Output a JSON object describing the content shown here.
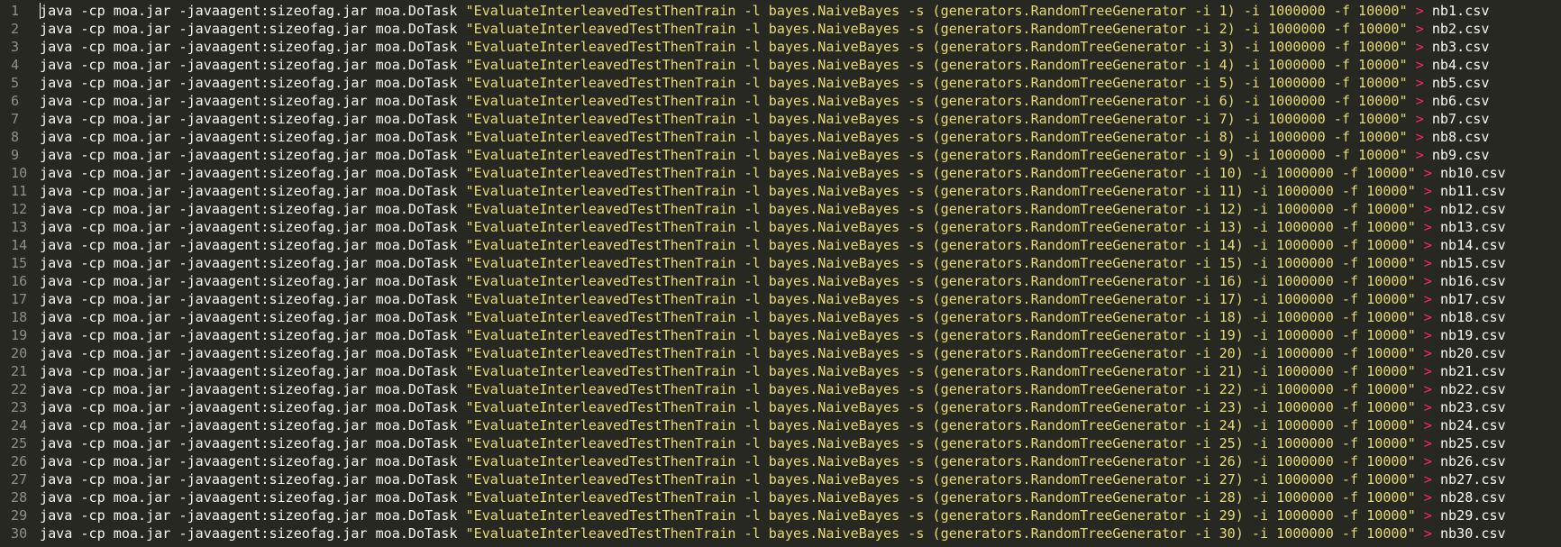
{
  "editor": {
    "colors": {
      "background": "#272822",
      "gutter_text": "#8f908a",
      "plain": "#f8f8f2",
      "string": "#e6db74",
      "operator": "#f92672"
    },
    "lines": [
      {
        "num": "1",
        "cmd": "java -cp moa.jar -javaagent:sizeofag.jar moa.DoTask ",
        "str": "\"EvaluateInterleavedTestThenTrain -l bayes.NaiveBayes -s (generators.RandomTreeGenerator -i 1) -i 1000000 -f 10000\"",
        "op": " > ",
        "out": "nb1.csv"
      },
      {
        "num": "2",
        "cmd": "java -cp moa.jar -javaagent:sizeofag.jar moa.DoTask ",
        "str": "\"EvaluateInterleavedTestThenTrain -l bayes.NaiveBayes -s (generators.RandomTreeGenerator -i 2) -i 1000000 -f 10000\"",
        "op": " > ",
        "out": "nb2.csv"
      },
      {
        "num": "3",
        "cmd": "java -cp moa.jar -javaagent:sizeofag.jar moa.DoTask ",
        "str": "\"EvaluateInterleavedTestThenTrain -l bayes.NaiveBayes -s (generators.RandomTreeGenerator -i 3) -i 1000000 -f 10000\"",
        "op": " > ",
        "out": "nb3.csv"
      },
      {
        "num": "4",
        "cmd": "java -cp moa.jar -javaagent:sizeofag.jar moa.DoTask ",
        "str": "\"EvaluateInterleavedTestThenTrain -l bayes.NaiveBayes -s (generators.RandomTreeGenerator -i 4) -i 1000000 -f 10000\"",
        "op": " > ",
        "out": "nb4.csv"
      },
      {
        "num": "5",
        "cmd": "java -cp moa.jar -javaagent:sizeofag.jar moa.DoTask ",
        "str": "\"EvaluateInterleavedTestThenTrain -l bayes.NaiveBayes -s (generators.RandomTreeGenerator -i 5) -i 1000000 -f 10000\"",
        "op": " > ",
        "out": "nb5.csv"
      },
      {
        "num": "6",
        "cmd": "java -cp moa.jar -javaagent:sizeofag.jar moa.DoTask ",
        "str": "\"EvaluateInterleavedTestThenTrain -l bayes.NaiveBayes -s (generators.RandomTreeGenerator -i 6) -i 1000000 -f 10000\"",
        "op": " > ",
        "out": "nb6.csv"
      },
      {
        "num": "7",
        "cmd": "java -cp moa.jar -javaagent:sizeofag.jar moa.DoTask ",
        "str": "\"EvaluateInterleavedTestThenTrain -l bayes.NaiveBayes -s (generators.RandomTreeGenerator -i 7) -i 1000000 -f 10000\"",
        "op": " > ",
        "out": "nb7.csv"
      },
      {
        "num": "8",
        "cmd": "java -cp moa.jar -javaagent:sizeofag.jar moa.DoTask ",
        "str": "\"EvaluateInterleavedTestThenTrain -l bayes.NaiveBayes -s (generators.RandomTreeGenerator -i 8) -i 1000000 -f 10000\"",
        "op": " > ",
        "out": "nb8.csv"
      },
      {
        "num": "9",
        "cmd": "java -cp moa.jar -javaagent:sizeofag.jar moa.DoTask ",
        "str": "\"EvaluateInterleavedTestThenTrain -l bayes.NaiveBayes -s (generators.RandomTreeGenerator -i 9) -i 1000000 -f 10000\"",
        "op": " > ",
        "out": "nb9.csv"
      },
      {
        "num": "10",
        "cmd": "java -cp moa.jar -javaagent:sizeofag.jar moa.DoTask ",
        "str": "\"EvaluateInterleavedTestThenTrain -l bayes.NaiveBayes -s (generators.RandomTreeGenerator -i 10) -i 1000000 -f 10000\"",
        "op": " > ",
        "out": "nb10.csv"
      },
      {
        "num": "11",
        "cmd": "java -cp moa.jar -javaagent:sizeofag.jar moa.DoTask ",
        "str": "\"EvaluateInterleavedTestThenTrain -l bayes.NaiveBayes -s (generators.RandomTreeGenerator -i 11) -i 1000000 -f 10000\"",
        "op": " > ",
        "out": "nb11.csv"
      },
      {
        "num": "12",
        "cmd": "java -cp moa.jar -javaagent:sizeofag.jar moa.DoTask ",
        "str": "\"EvaluateInterleavedTestThenTrain -l bayes.NaiveBayes -s (generators.RandomTreeGenerator -i 12) -i 1000000 -f 10000\"",
        "op": " > ",
        "out": "nb12.csv"
      },
      {
        "num": "13",
        "cmd": "java -cp moa.jar -javaagent:sizeofag.jar moa.DoTask ",
        "str": "\"EvaluateInterleavedTestThenTrain -l bayes.NaiveBayes -s (generators.RandomTreeGenerator -i 13) -i 1000000 -f 10000\"",
        "op": " > ",
        "out": "nb13.csv"
      },
      {
        "num": "14",
        "cmd": "java -cp moa.jar -javaagent:sizeofag.jar moa.DoTask ",
        "str": "\"EvaluateInterleavedTestThenTrain -l bayes.NaiveBayes -s (generators.RandomTreeGenerator -i 14) -i 1000000 -f 10000\"",
        "op": " > ",
        "out": "nb14.csv"
      },
      {
        "num": "15",
        "cmd": "java -cp moa.jar -javaagent:sizeofag.jar moa.DoTask ",
        "str": "\"EvaluateInterleavedTestThenTrain -l bayes.NaiveBayes -s (generators.RandomTreeGenerator -i 15) -i 1000000 -f 10000\"",
        "op": " > ",
        "out": "nb15.csv"
      },
      {
        "num": "16",
        "cmd": "java -cp moa.jar -javaagent:sizeofag.jar moa.DoTask ",
        "str": "\"EvaluateInterleavedTestThenTrain -l bayes.NaiveBayes -s (generators.RandomTreeGenerator -i 16) -i 1000000 -f 10000\"",
        "op": " > ",
        "out": "nb16.csv"
      },
      {
        "num": "17",
        "cmd": "java -cp moa.jar -javaagent:sizeofag.jar moa.DoTask ",
        "str": "\"EvaluateInterleavedTestThenTrain -l bayes.NaiveBayes -s (generators.RandomTreeGenerator -i 17) -i 1000000 -f 10000\"",
        "op": " > ",
        "out": "nb17.csv"
      },
      {
        "num": "18",
        "cmd": "java -cp moa.jar -javaagent:sizeofag.jar moa.DoTask ",
        "str": "\"EvaluateInterleavedTestThenTrain -l bayes.NaiveBayes -s (generators.RandomTreeGenerator -i 18) -i 1000000 -f 10000\"",
        "op": " > ",
        "out": "nb18.csv"
      },
      {
        "num": "19",
        "cmd": "java -cp moa.jar -javaagent:sizeofag.jar moa.DoTask ",
        "str": "\"EvaluateInterleavedTestThenTrain -l bayes.NaiveBayes -s (generators.RandomTreeGenerator -i 19) -i 1000000 -f 10000\"",
        "op": " > ",
        "out": "nb19.csv"
      },
      {
        "num": "20",
        "cmd": "java -cp moa.jar -javaagent:sizeofag.jar moa.DoTask ",
        "str": "\"EvaluateInterleavedTestThenTrain -l bayes.NaiveBayes -s (generators.RandomTreeGenerator -i 20) -i 1000000 -f 10000\"",
        "op": " > ",
        "out": "nb20.csv"
      },
      {
        "num": "21",
        "cmd": "java -cp moa.jar -javaagent:sizeofag.jar moa.DoTask ",
        "str": "\"EvaluateInterleavedTestThenTrain -l bayes.NaiveBayes -s (generators.RandomTreeGenerator -i 21) -i 1000000 -f 10000\"",
        "op": " > ",
        "out": "nb21.csv"
      },
      {
        "num": "22",
        "cmd": "java -cp moa.jar -javaagent:sizeofag.jar moa.DoTask ",
        "str": "\"EvaluateInterleavedTestThenTrain -l bayes.NaiveBayes -s (generators.RandomTreeGenerator -i 22) -i 1000000 -f 10000\"",
        "op": " > ",
        "out": "nb22.csv"
      },
      {
        "num": "23",
        "cmd": "java -cp moa.jar -javaagent:sizeofag.jar moa.DoTask ",
        "str": "\"EvaluateInterleavedTestThenTrain -l bayes.NaiveBayes -s (generators.RandomTreeGenerator -i 23) -i 1000000 -f 10000\"",
        "op": " > ",
        "out": "nb23.csv"
      },
      {
        "num": "24",
        "cmd": "java -cp moa.jar -javaagent:sizeofag.jar moa.DoTask ",
        "str": "\"EvaluateInterleavedTestThenTrain -l bayes.NaiveBayes -s (generators.RandomTreeGenerator -i 24) -i 1000000 -f 10000\"",
        "op": " > ",
        "out": "nb24.csv"
      },
      {
        "num": "25",
        "cmd": "java -cp moa.jar -javaagent:sizeofag.jar moa.DoTask ",
        "str": "\"EvaluateInterleavedTestThenTrain -l bayes.NaiveBayes -s (generators.RandomTreeGenerator -i 25) -i 1000000 -f 10000\"",
        "op": " > ",
        "out": "nb25.csv"
      },
      {
        "num": "26",
        "cmd": "java -cp moa.jar -javaagent:sizeofag.jar moa.DoTask ",
        "str": "\"EvaluateInterleavedTestThenTrain -l bayes.NaiveBayes -s (generators.RandomTreeGenerator -i 26) -i 1000000 -f 10000\"",
        "op": " > ",
        "out": "nb26.csv"
      },
      {
        "num": "27",
        "cmd": "java -cp moa.jar -javaagent:sizeofag.jar moa.DoTask ",
        "str": "\"EvaluateInterleavedTestThenTrain -l bayes.NaiveBayes -s (generators.RandomTreeGenerator -i 27) -i 1000000 -f 10000\"",
        "op": " > ",
        "out": "nb27.csv"
      },
      {
        "num": "28",
        "cmd": "java -cp moa.jar -javaagent:sizeofag.jar moa.DoTask ",
        "str": "\"EvaluateInterleavedTestThenTrain -l bayes.NaiveBayes -s (generators.RandomTreeGenerator -i 28) -i 1000000 -f 10000\"",
        "op": " > ",
        "out": "nb28.csv"
      },
      {
        "num": "29",
        "cmd": "java -cp moa.jar -javaagent:sizeofag.jar moa.DoTask ",
        "str": "\"EvaluateInterleavedTestThenTrain -l bayes.NaiveBayes -s (generators.RandomTreeGenerator -i 29) -i 1000000 -f 10000\"",
        "op": " > ",
        "out": "nb29.csv"
      },
      {
        "num": "30",
        "cmd": "java -cp moa.jar -javaagent:sizeofag.jar moa.DoTask ",
        "str": "\"EvaluateInterleavedTestThenTrain -l bayes.NaiveBayes -s (generators.RandomTreeGenerator -i 30) -i 1000000 -f 10000\"",
        "op": " > ",
        "out": "nb30.csv"
      }
    ]
  }
}
